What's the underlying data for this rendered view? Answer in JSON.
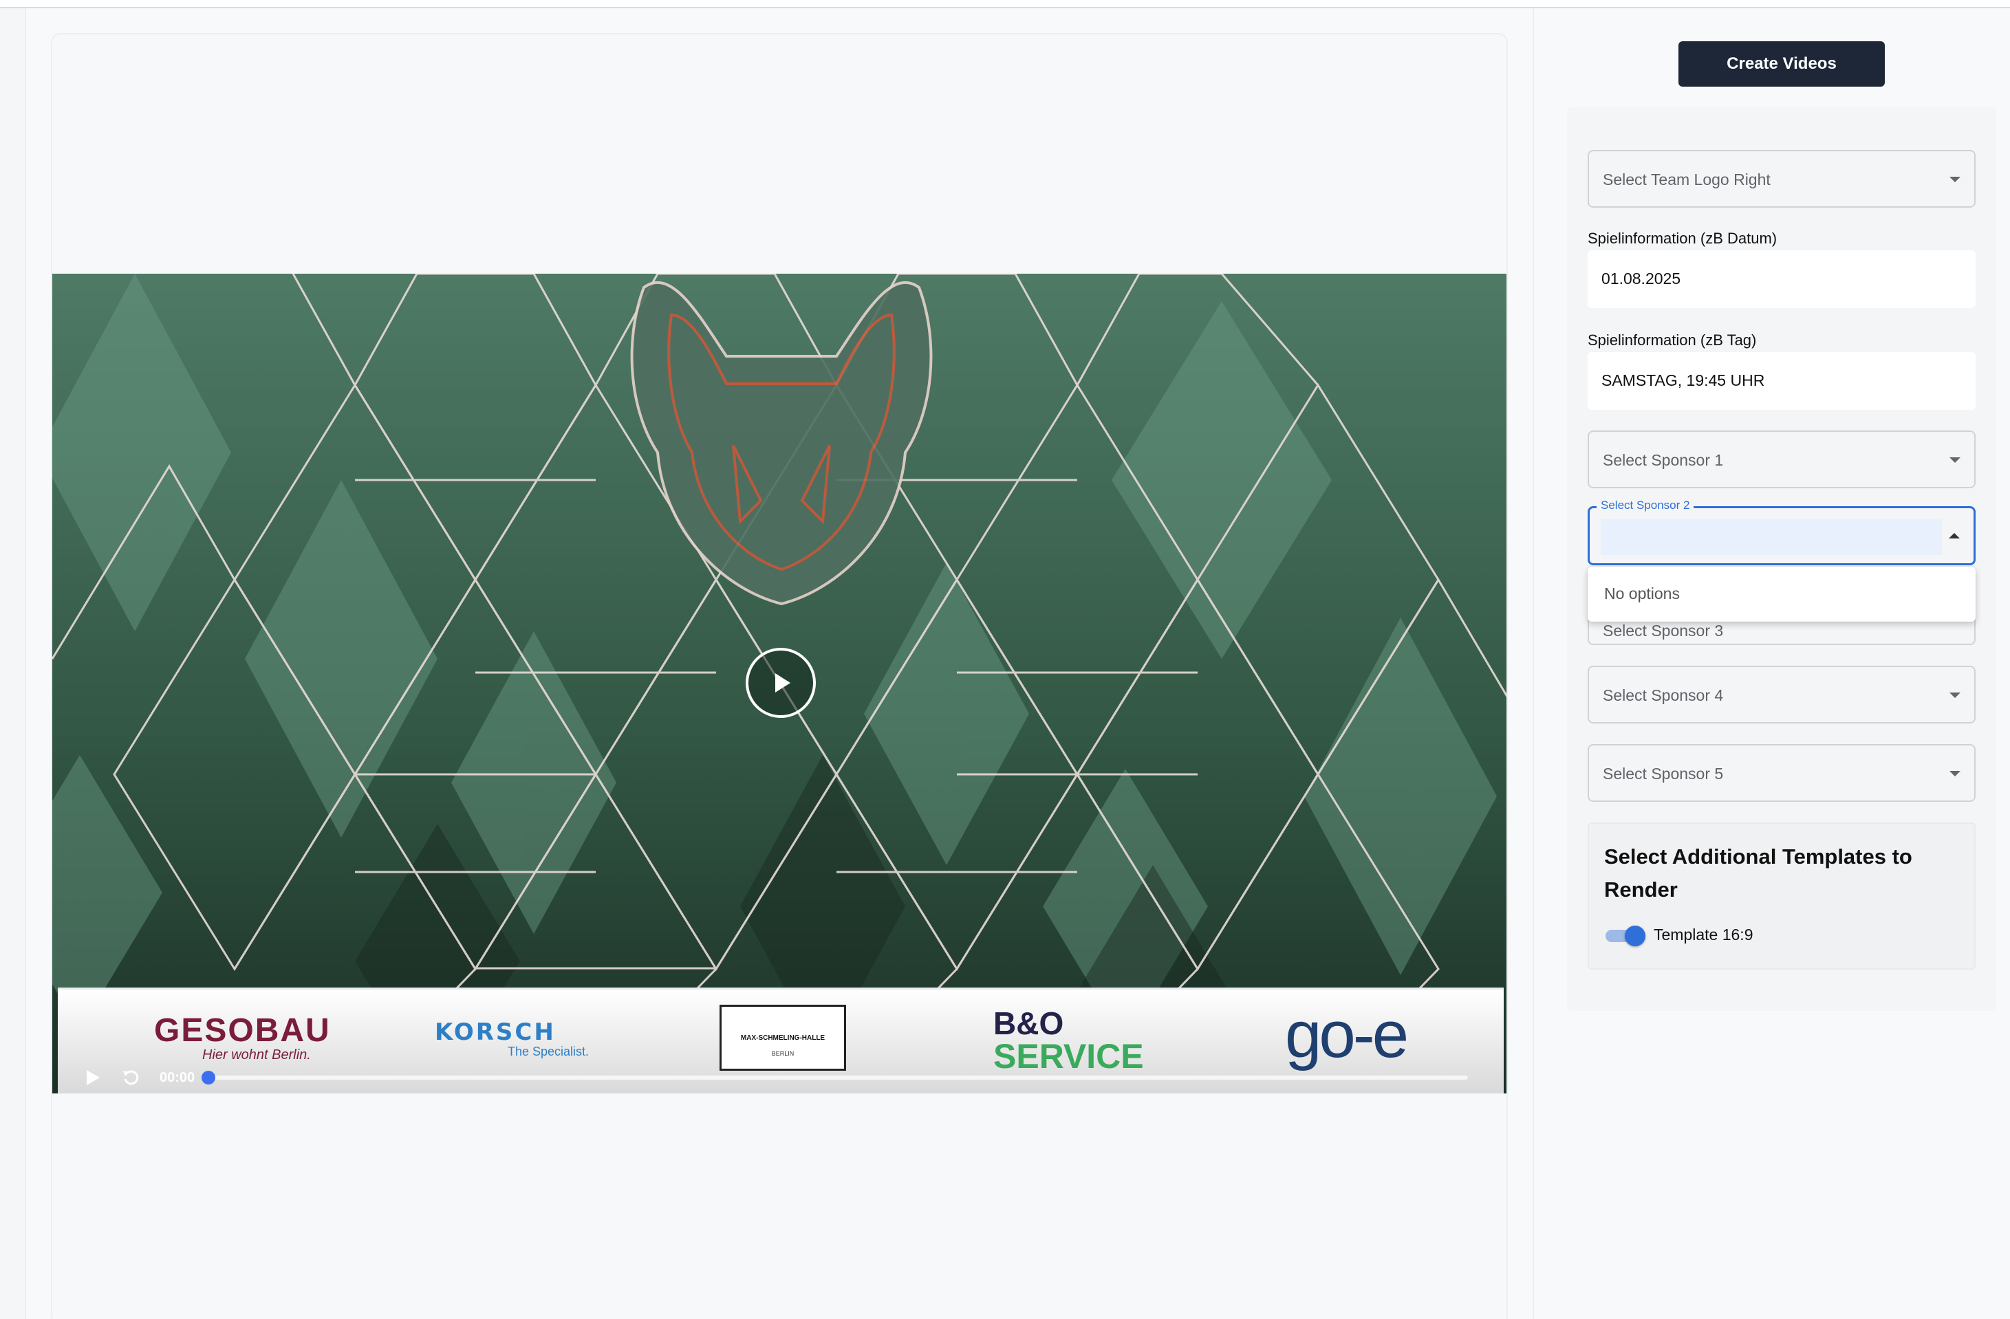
{
  "video": {
    "time": "00:00",
    "progress": 0.0,
    "sponsors": [
      {
        "name": "GESOBAU",
        "tagline": "Hier wohnt Berlin."
      },
      {
        "name": "KORSCH",
        "tagline": "The Specialist."
      },
      {
        "name": "MAX-SCHMELING-HALLE",
        "tagline": "BERLIN"
      },
      {
        "name": "B&O",
        "tagline": "SERVICE"
      },
      {
        "name": "go-e",
        "tagline": ""
      }
    ]
  },
  "sidebar": {
    "create_button": "Create Videos",
    "team_logo_right": {
      "placeholder": "Select Team Logo Right"
    },
    "spielinfo_datum": {
      "label": "Spielinformation (zB Datum)",
      "value": "01.08.2025"
    },
    "spielinfo_tag": {
      "label": "Spielinformation (zB Tag)",
      "value": "SAMSTAG, 19:45 UHR"
    },
    "sponsor1": {
      "placeholder": "Select Sponsor 1"
    },
    "sponsor2": {
      "label": "Select Sponsor 2",
      "value": "",
      "dropdown_text": "No options"
    },
    "sponsor3": {
      "placeholder": "Select Sponsor 3"
    },
    "sponsor4": {
      "placeholder": "Select Sponsor 4"
    },
    "sponsor5": {
      "placeholder": "Select Sponsor 5"
    },
    "templates": {
      "title": "Select Additional Templates to Render",
      "toggle_label": "Template 16:9",
      "toggle_on": true
    }
  },
  "colors": {
    "primary_button": "#1e2738",
    "accent_blue": "#2f6fd8",
    "video_green": "#365a49"
  }
}
